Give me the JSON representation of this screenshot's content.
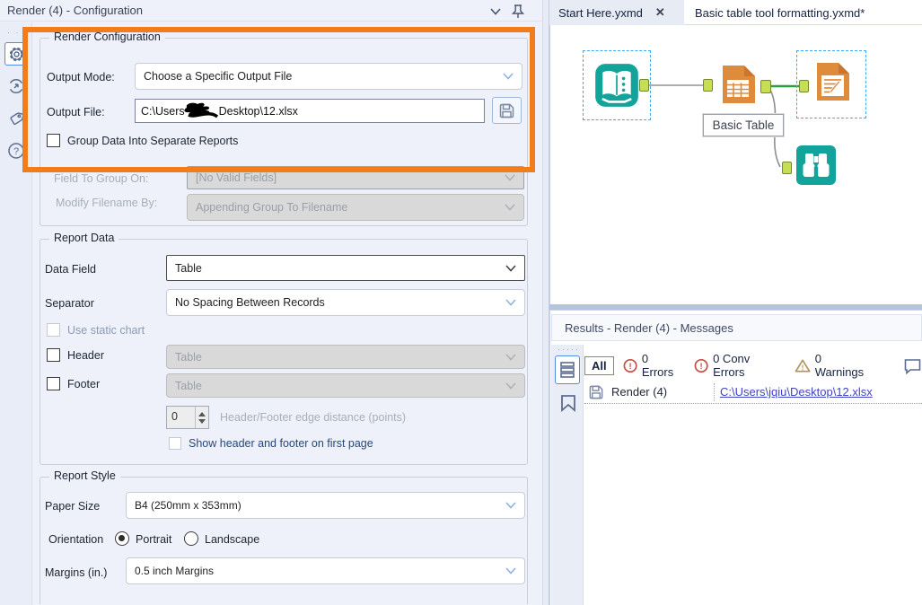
{
  "colors": {
    "highlight_orange": "#F07D1A",
    "tool_teal": "#12A49B",
    "tool_orange": "#DE8C3C",
    "selection_blue": "#3FA9F5",
    "anchor_green": "#C6DE53",
    "wire_green": "#2E9E44",
    "link_blue": "#4044C9",
    "error_red": "#C5504B",
    "warning_tan": "#B39059",
    "accent_blue": "#4F8EE8"
  },
  "icons": {
    "config_sidebar": [
      "drag-handle-dots",
      "gear-icon",
      "performance-icon",
      "annotation-icon",
      "help-icon"
    ],
    "header": [
      "chevron-down-icon",
      "pin-icon"
    ],
    "output_file": [
      "save-icon",
      "redaction-scribble"
    ],
    "results_sidebar": [
      "drag-handle-dots",
      "messages-icon",
      "flag-icon"
    ],
    "results_toolbar": [
      "error-icon",
      "error-icon",
      "warning-icon",
      "comment-icon"
    ],
    "results_row": [
      "save-icon"
    ],
    "canvas_tools": [
      "book-icon",
      "table-icon",
      "render-icon",
      "binoculars-icon"
    ]
  },
  "config_panel": {
    "title": "Render (4) - Configuration",
    "render_config": {
      "legend": "Render Configuration",
      "output_mode_label": "Output Mode:",
      "output_mode_value": "Choose a Specific Output File",
      "output_file_label": "Output File:",
      "output_file_prefix": "C:\\Users",
      "output_file_suffix": "Desktop\\12.xlsx",
      "group_checkbox_label": "Group Data Into Separate Reports",
      "field_to_group_label": "Field To Group On:",
      "field_to_group_value": "[No Valid Fields]",
      "modify_filename_label": "Modify Filename By:",
      "modify_filename_value": "Appending Group To Filename"
    },
    "report_data": {
      "legend": "Report Data",
      "data_field_label": "Data Field",
      "data_field_value": "Table",
      "separator_label": "Separator",
      "separator_value": "No Spacing Between Records",
      "use_static_chart_label": "Use static chart",
      "header_label": "Header",
      "header_value": "Table",
      "footer_label": "Footer",
      "footer_value": "Table",
      "edge_distance_value": "0",
      "edge_distance_label": "Header/Footer edge distance (points)",
      "show_header_footer_label": "Show header and footer on first page"
    },
    "report_style": {
      "legend": "Report Style",
      "paper_size_label": "Paper Size",
      "paper_size_value": "B4 (250mm x 353mm)",
      "orientation_label": "Orientation",
      "portrait_label": "Portrait",
      "landscape_label": "Landscape",
      "margins_label": "Margins (in.)",
      "margins_value": "0.5 inch Margins"
    }
  },
  "canvas": {
    "tabs": [
      {
        "label": "Start Here.yxmd",
        "closable": true
      },
      {
        "label": "Basic table tool formatting.yxmd*",
        "closable": false
      }
    ],
    "tools": [
      {
        "name": "text-input"
      },
      {
        "name": "basic-table",
        "label": "Basic Table"
      },
      {
        "name": "render"
      },
      {
        "name": "browse"
      }
    ]
  },
  "results": {
    "title": "Results - Render (4) - Messages",
    "filter_all": "All",
    "errors": "0 Errors",
    "conv_errors": "0 Conv Errors",
    "warnings": "0 Warnings",
    "row": {
      "tool": "Render (4)",
      "link": "C:\\Users\\jqiu\\Desktop\\12.xlsx"
    }
  }
}
